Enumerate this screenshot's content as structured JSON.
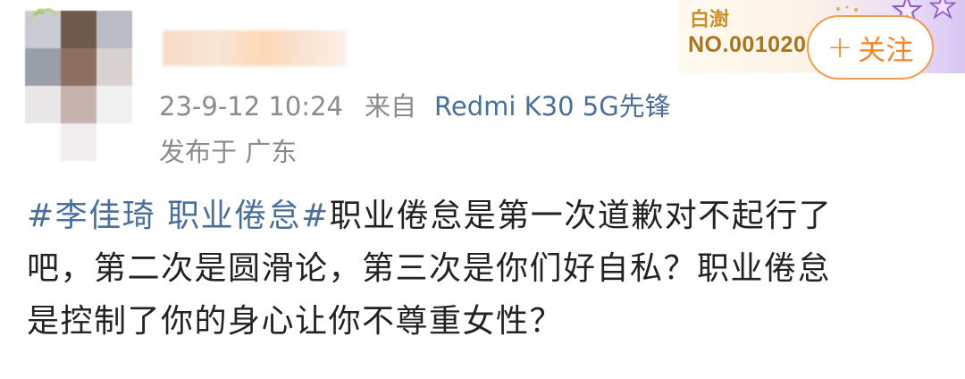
{
  "post": {
    "timestamp": "23-9-12 10:24",
    "from_label": "来自",
    "device": "Redmi K30 5G先锋",
    "location": "发布于 广东",
    "topic": "#李佳琦 职业倦怠#",
    "body_line1": "职业倦怠是第一次道歉对不起行了",
    "body_line2": "吧，第二次是圆滑论，第三次是你们好自私？职业倦怠",
    "body_line3": "是控制了你的身心让你不尊重女性？"
  },
  "fan_badge": {
    "name": "白澍",
    "number": "NO.001020"
  },
  "follow_button": {
    "plus": "+",
    "label": "关注"
  },
  "colors": {
    "link": "#4a6f99",
    "meta": "#8b8b8b",
    "follow_accent": "#f3862a",
    "badge_gold": "#a8741f"
  }
}
